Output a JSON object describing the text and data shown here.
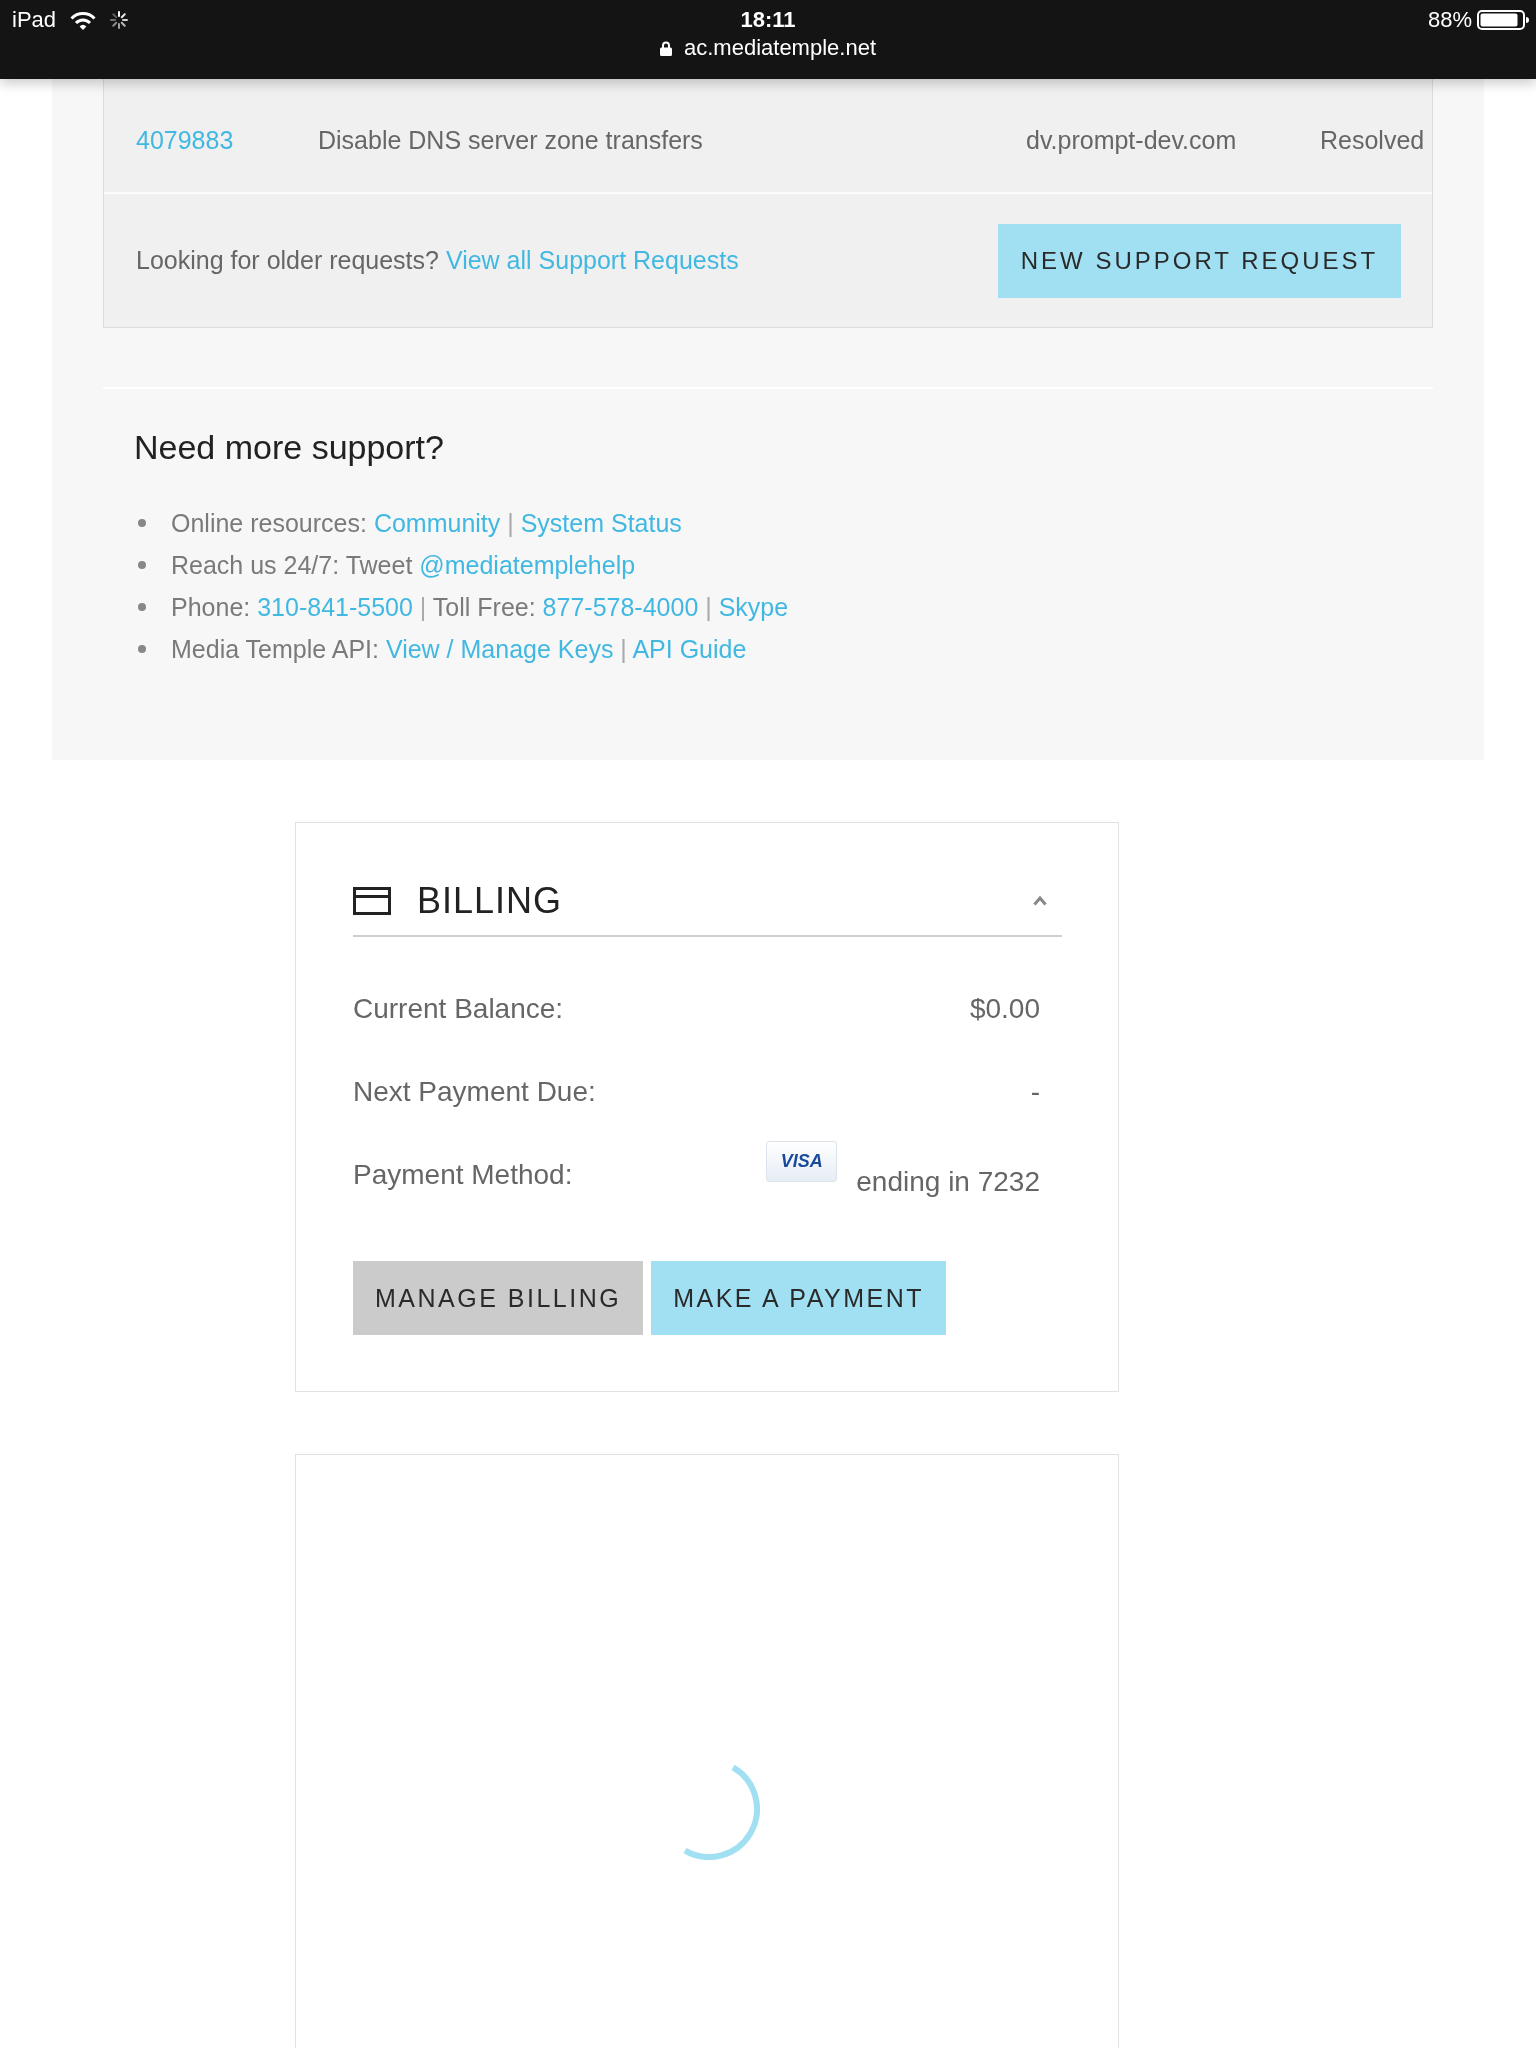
{
  "status_bar": {
    "device": "iPad",
    "time": "18:11",
    "url": "ac.mediatemple.net",
    "battery": "88%"
  },
  "support_requests": {
    "rows": [
      {
        "id": "4079883",
        "subject": "Disable DNS server zone transfers",
        "domain": "dv.prompt-dev.com",
        "status": "Resolved"
      }
    ],
    "footer_text": "Looking for older requests?",
    "footer_link": "View all Support Requests",
    "new_request_button": "NEW SUPPORT REQUEST"
  },
  "more_support": {
    "title": "Need more support?",
    "items": [
      {
        "parts": [
          {
            "kind": "text",
            "text": "Online resources: "
          },
          {
            "kind": "link",
            "text": "Community"
          },
          {
            "kind": "separator",
            "text": " | "
          },
          {
            "kind": "link",
            "text": "System Status"
          }
        ]
      },
      {
        "parts": [
          {
            "kind": "text",
            "text": "Reach us 24/7: Tweet "
          },
          {
            "kind": "link",
            "text": "@mediatemplehelp"
          }
        ]
      },
      {
        "parts": [
          {
            "kind": "text",
            "text": "Phone: "
          },
          {
            "kind": "link",
            "text": "310-841-5500"
          },
          {
            "kind": "separator",
            "text": " | "
          },
          {
            "kind": "text",
            "text": "Toll Free: "
          },
          {
            "kind": "link",
            "text": "877-578-4000"
          },
          {
            "kind": "separator",
            "text": " | "
          },
          {
            "kind": "link",
            "text": "Skype"
          }
        ]
      },
      {
        "parts": [
          {
            "kind": "text",
            "text": "Media Temple API: "
          },
          {
            "kind": "link",
            "text": "View / Manage Keys"
          },
          {
            "kind": "separator",
            "text": " | "
          },
          {
            "kind": "link",
            "text": "API Guide"
          }
        ]
      }
    ]
  },
  "billing": {
    "title": "BILLING",
    "expanded": true,
    "rows": [
      {
        "label": "Current Balance:",
        "value": "$0.00"
      },
      {
        "label": "Next Payment Due:",
        "value": "-"
      },
      {
        "label": "Payment Method:",
        "card_brand": "VISA",
        "value": "ending in 7232"
      }
    ],
    "buttons": [
      {
        "label": "MANAGE BILLING",
        "kind": "secondary"
      },
      {
        "label": "MAKE A PAYMENT",
        "kind": "primary"
      }
    ]
  },
  "loading_panel": {
    "loading": true
  }
}
